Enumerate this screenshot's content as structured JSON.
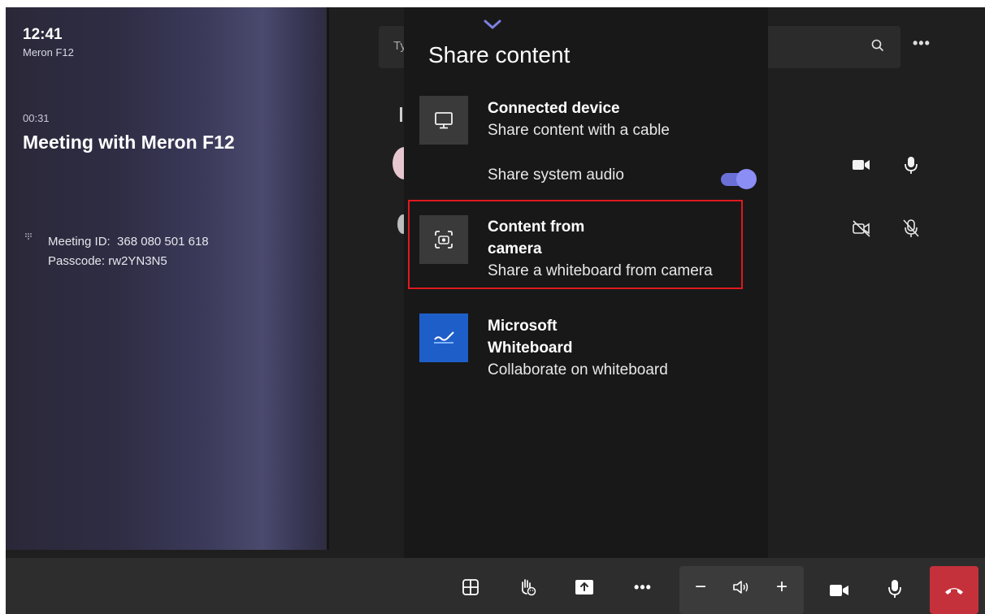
{
  "status": {
    "time": "12:41",
    "device": "Meron F12"
  },
  "meeting": {
    "timer": "00:31",
    "title": "Meeting with Meron F12",
    "meeting_id": "Meeting ID:  368 080 501 618",
    "passcode": "Passcode: rw2YN3N5"
  },
  "search": {
    "placeholder": "Ty"
  },
  "share": {
    "title": "Share content",
    "items": [
      {
        "title": "Connected device",
        "subtitle": "Share content with a cable",
        "icon": "monitor-icon"
      },
      {
        "title": "Content from camera",
        "subtitle": "Share a whiteboard from camera",
        "icon": "camera-capture-icon",
        "highlighted": true
      },
      {
        "title": "Microsoft Whiteboard",
        "subtitle": "Collaborate on whiteboard",
        "icon": "whiteboard-icon"
      }
    ],
    "audio": {
      "label": "Share system audio",
      "enabled": true
    }
  },
  "toolbar": {
    "more_label": "•••",
    "minus_label": "−",
    "plus_label": "+"
  },
  "colors": {
    "accent": "#6b70d6",
    "highlight": "#e0191f",
    "hangup": "#c4313b",
    "whiteboard": "#1e5ec9"
  }
}
